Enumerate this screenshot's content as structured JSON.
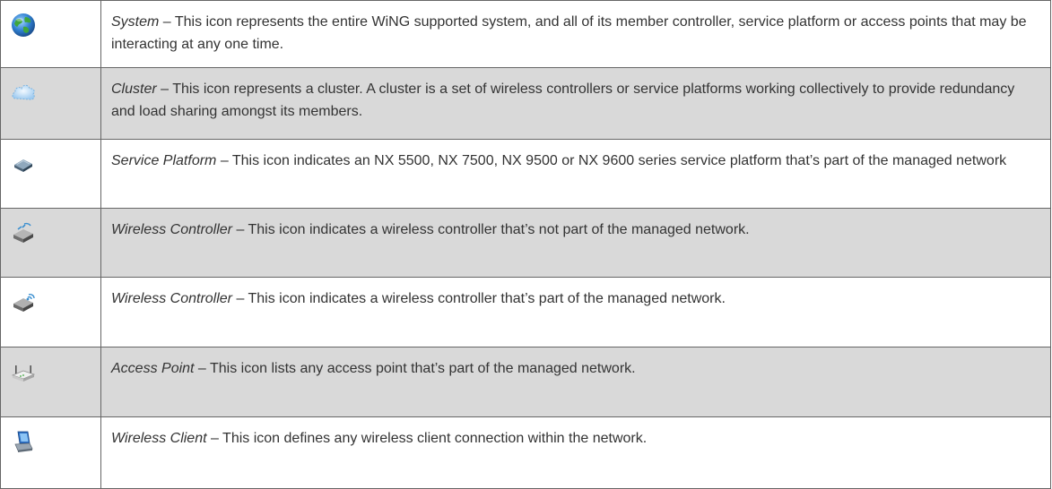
{
  "rows": [
    {
      "icon": "globe-icon",
      "term": "System",
      "text": " – This icon represents the entire WiNG supported system, and all of its member controller, service platform or access points that may be interacting at any one time."
    },
    {
      "icon": "cloud-icon",
      "term": "Cluster",
      "text": " – This icon represents a cluster. A cluster is a set of wireless controllers or service platforms working collectively to provide redundancy and load sharing amongst its members."
    },
    {
      "icon": "service-platform-icon",
      "term": "Service Platform",
      "text": " – This icon indicates an NX 5500, NX 7500, NX 9500 or NX 9600 series service platform that’s part of the managed network"
    },
    {
      "icon": "unmanaged-controller-icon",
      "term": "Wireless Controller",
      "text": " – This icon indicates a wireless controller that’s not part of the managed network."
    },
    {
      "icon": "managed-controller-icon",
      "term": "Wireless Controller",
      "text": " – This icon indicates a wireless controller that’s part of the managed network."
    },
    {
      "icon": "access-point-icon",
      "term": "Access Point",
      "text": " – This icon lists any access point that’s part of the managed network."
    },
    {
      "icon": "wireless-client-icon",
      "term": "Wireless Client",
      "text": " – This icon defines any wireless client connection within the network."
    }
  ],
  "colors": {
    "shaded_row": "#d9d9d9",
    "border": "#666666",
    "text": "#333333"
  }
}
